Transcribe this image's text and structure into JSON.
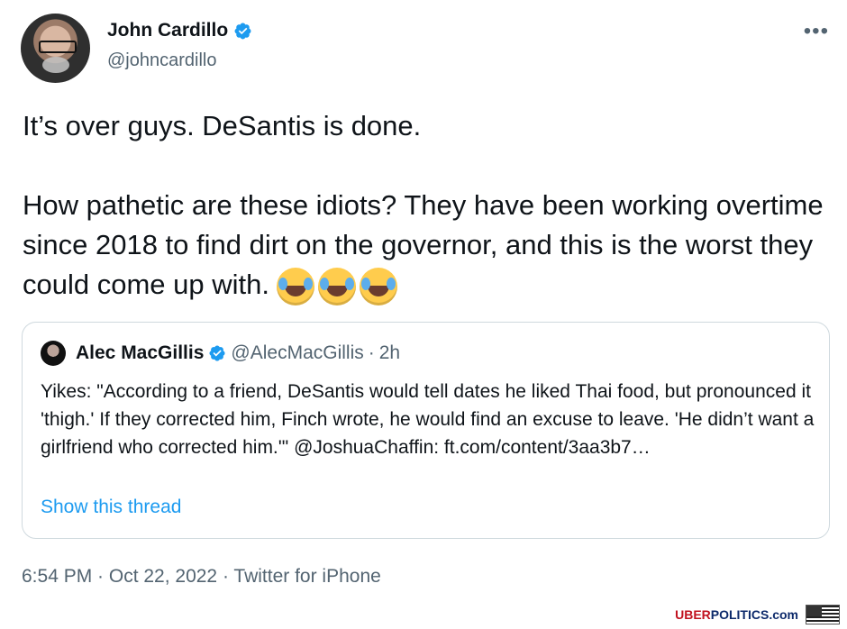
{
  "author": {
    "name": "John Cardillo",
    "handle": "@johncardillo"
  },
  "more_label": "•••",
  "tweet": {
    "text": "It’s over guys. DeSantis is done.\n\nHow pathetic are these idiots? They have been working overtime since 2018 to find dirt on the governor, and this is the worst they could come up with."
  },
  "quote": {
    "name": "Alec MacGillis",
    "handle": "@AlecMacGillis",
    "separator": "·",
    "time": "2h",
    "text": "Yikes: \"According to a friend, DeSantis would tell dates he liked Thai food, but pronounced it 'thigh.' If they corrected him, Finch wrote, he would find an excuse to leave. 'He didn’t want a girlfriend who corrected him.'\" @JoshuaChaffin: ft.com/content/3aa3b7…",
    "show_thread": "Show this thread"
  },
  "meta": "6:54 PM · Oct 22, 2022 · Twitter for iPhone",
  "watermark": {
    "part1": "UBER",
    "part2": "POLITICS.com"
  },
  "colors": {
    "accent": "#1d9bf0",
    "text": "#0f1419",
    "secondary": "#536471",
    "border": "#cfd9de"
  },
  "icons": [
    "verified-badge-icon",
    "more-icon",
    "laughing-emoji-icon",
    "us-flag-icon"
  ]
}
